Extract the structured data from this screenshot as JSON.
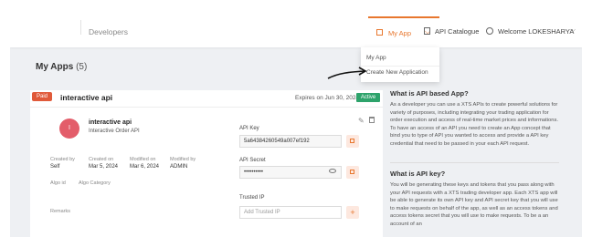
{
  "header": {
    "brand": "Developers",
    "nav": [
      {
        "label": "My App",
        "icon": "grid-icon"
      },
      {
        "label": "API Catalogue",
        "icon": "calendar-icon"
      },
      {
        "label": "Welcome LOKESHARYA",
        "icon": "user-icon"
      }
    ]
  },
  "dropdown": {
    "items": [
      "My App",
      "Create New Application"
    ]
  },
  "page": {
    "title": "My Apps",
    "count": "(5)"
  },
  "app_card": {
    "badge": "Paid",
    "name": "interactive api",
    "expires": "Expires on Jun 30, 2024",
    "status": "Active",
    "avatar_letter": "I",
    "title": "interactive api",
    "description": "Interactive Order API",
    "meta": [
      {
        "label": "Created by",
        "value": "Self"
      },
      {
        "label": "Created on",
        "value": "Mar 5, 2024"
      },
      {
        "label": "Modified on",
        "value": "Mar 6, 2024"
      },
      {
        "label": "Modified by",
        "value": "ADMIN"
      }
    ],
    "algo_id_label": "Algo id",
    "algo_category_label": "Algo Category",
    "remarks_label": "Remarks",
    "api_key_label": "API Key",
    "api_key_value": "5a64384260549a007ef192",
    "api_secret_label": "API Secret",
    "api_secret_value": "••••••••••",
    "trusted_ip_label": "Trusted IP",
    "trusted_ip_placeholder": "Add Trusted IP"
  },
  "info": {
    "h1": "What is API based App?",
    "p1": "As a developer you can use a XTS APIs to create powerful solutions for variety of purposes, including integrating your trading application for order execution and access of real-time market prices and informations. To have an access of an API you need to create an App concept that bind you to type of API you wanted to access and provide a API key credential that need to be passed in your each API request.",
    "h2": "What is API key?",
    "p2": "You will be generating these keys and tokens that you pass along with your API requests with a XTS trading developer app. Each XTS app will be able to generate its own API key and API secret key that you will use to make requests on behalf of the app, as well as an access tokens and access tokens secret that you will use to make requests. To be a an account of an"
  },
  "colors": {
    "accent": "#e8772e",
    "paid": "#e05a3a",
    "active": "#2ea36b",
    "avatar": "#e35d6a"
  }
}
